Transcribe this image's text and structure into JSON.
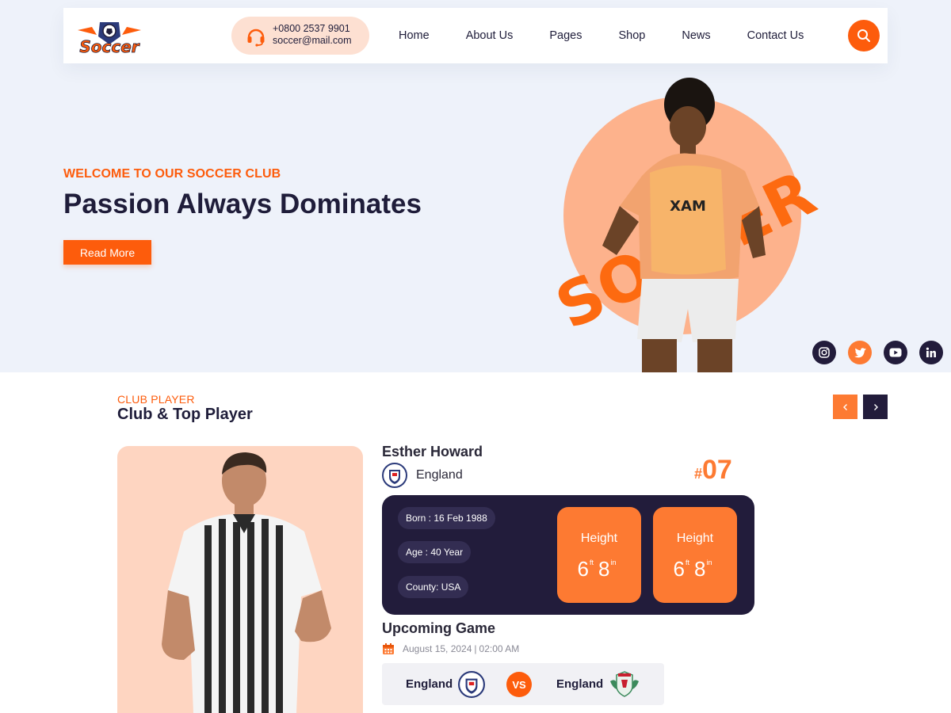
{
  "brand": {
    "logo_text": "Soccer"
  },
  "contact": {
    "phone": "+0800 2537 9901",
    "email": "soccer@mail.com"
  },
  "nav": {
    "items": [
      {
        "label": "Home"
      },
      {
        "label": "About Us"
      },
      {
        "label": "Pages"
      },
      {
        "label": "Shop"
      },
      {
        "label": "News"
      },
      {
        "label": "Contact Us"
      }
    ]
  },
  "hero": {
    "subtitle": "WELCOME TO OUR SOCCER CLUB",
    "title": "Passion Always Dominates",
    "button_label": "Read More",
    "overlay_word": "SOCCER"
  },
  "social": [
    "instagram-icon",
    "twitter-icon",
    "youtube-icon",
    "linkedin-icon"
  ],
  "section": {
    "subtitle": "CLUB PLAYER",
    "title": "Club & Top Player"
  },
  "player": {
    "name": "Esther Howard",
    "country": "England",
    "jersey_hash": "#",
    "jersey_number": "07",
    "born": "Born : 16 Feb 1988",
    "age": "Age : 40 Year",
    "county": "County: USA",
    "stats": [
      {
        "label": "Height",
        "feet": "6",
        "feet_unit": "ft",
        "inches": "8",
        "inches_unit": "in"
      },
      {
        "label": "Height",
        "feet": "6",
        "feet_unit": "ft",
        "inches": "8",
        "inches_unit": "in"
      }
    ]
  },
  "upcoming": {
    "title": "Upcoming Game",
    "date": "August 15, 2024",
    "separator": "|",
    "time": "02:00 AM",
    "team_home": "England",
    "vs_label": "VS",
    "team_away": "England"
  },
  "colors": {
    "accent": "#fd5c0c",
    "accent_light": "#fd7a32",
    "navy": "#221c3b",
    "hero_bg": "#eef2fa",
    "peach": "#fed5c1"
  }
}
